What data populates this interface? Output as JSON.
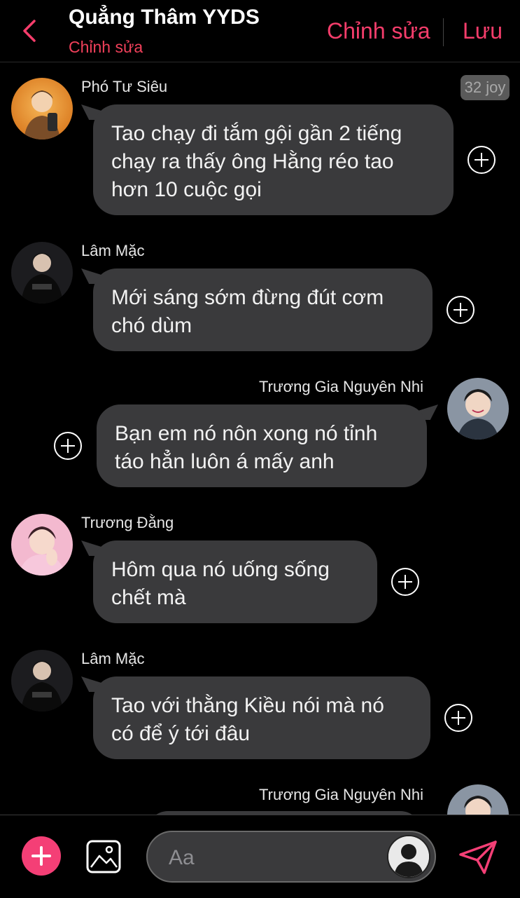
{
  "header": {
    "title": "Quẳng Thâm YYDS",
    "subtitle": "Chỉnh sửa",
    "edit_label": "Chỉnh sửa",
    "save_label": "Lưu",
    "accent_color": "#f53d6b"
  },
  "badge": "32 joy",
  "messages": [
    {
      "sender": "Phó Tư Siêu",
      "side": "left",
      "lines": [
        "Tao chạy đi tắm gội gần 2 tiếng",
        "chạy ra thấy ông Hằng réo tao",
        "hơn 10 cuộc gọi"
      ]
    },
    {
      "sender": "Lâm Mặc",
      "side": "left",
      "lines": [
        "Mới sáng sớm đừng đút cơm",
        "chó dùm"
      ]
    },
    {
      "sender": "Trương Gia Nguyên Nhi",
      "side": "right",
      "lines": [
        "Bạn em nó nôn xong nó tỉnh",
        "táo hẳn luôn á mấy anh"
      ]
    },
    {
      "sender": "Trương Đằng",
      "side": "left",
      "lines": [
        "Hôm qua nó uống sống",
        "chết mà"
      ]
    },
    {
      "sender": "Lâm Mặc",
      "side": "left",
      "lines": [
        "Tao với thằng Kiều nói mà nó",
        "có để ý tới đâu"
      ]
    },
    {
      "sender": "Trương Gia Nguyên Nhi",
      "side": "right",
      "lines": []
    }
  ],
  "composer": {
    "placeholder": "Aa"
  },
  "colors": {
    "bubble": "#3a3a3c",
    "accent": "#f43f76",
    "background": "#000000"
  }
}
